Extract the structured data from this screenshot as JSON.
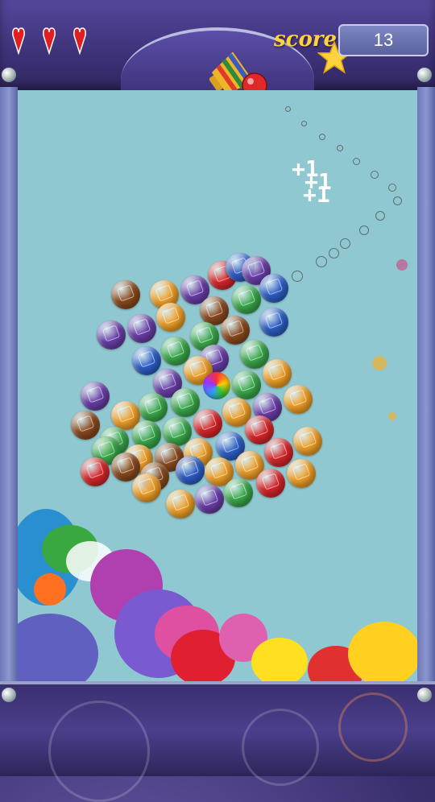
{
  "hud": {
    "lives": 3,
    "score_label": "score",
    "score_value": "13"
  },
  "cannon": {
    "loaded_bubble_color": "#e02828"
  },
  "floating_text": [
    "+1",
    "+1",
    "+1"
  ],
  "colors": {
    "playfield": "#8fc8d0",
    "frame": "#3d3279",
    "accent": "#ffd23f"
  },
  "bubble_palette": {
    "purple": "#6a3ea8",
    "orange": "#f0a028",
    "red": "#d8262a",
    "blue": "#2e5fc8",
    "green": "#3aa84a",
    "brown": "#8a4a1e"
  }
}
